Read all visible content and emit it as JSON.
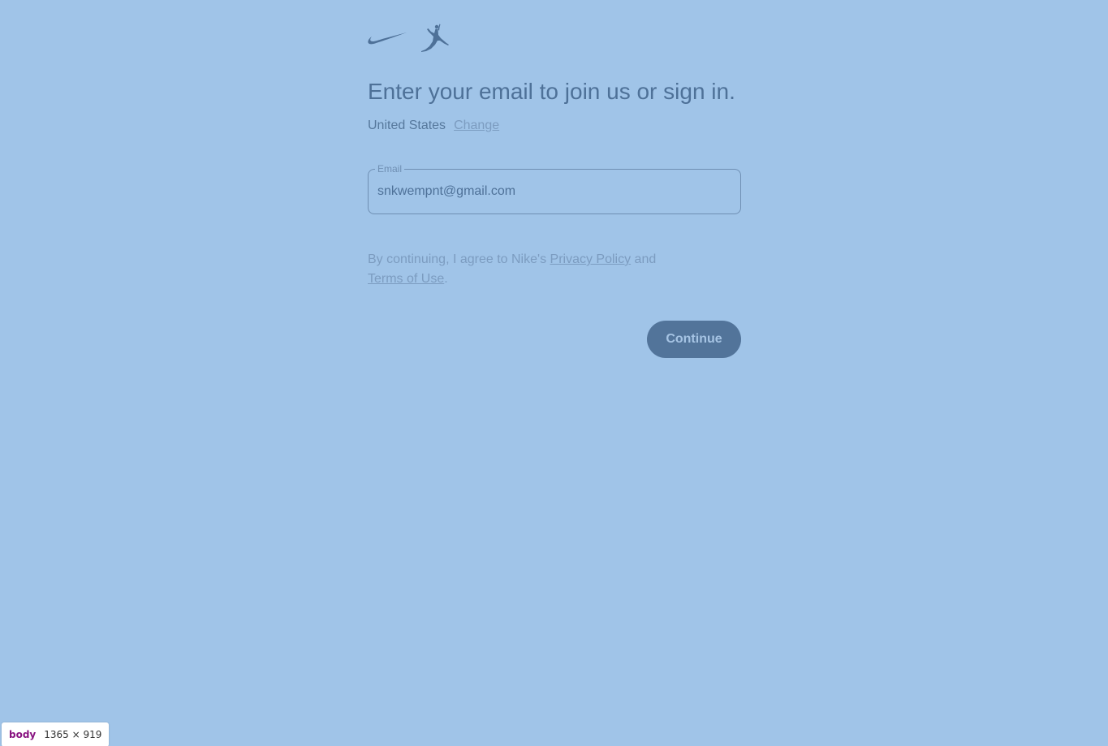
{
  "logos": {
    "nike": "nike-swoosh-icon",
    "jordan": "jumpman-icon",
    "color": "#4e7198"
  },
  "heading": "Enter your email to join us or sign in.",
  "location": {
    "country": "United States",
    "change_label": "Change"
  },
  "email_field": {
    "label": "Email",
    "value": "snkwempnt@gmail.com"
  },
  "terms": {
    "prefix": "By continuing, I agree to Nike's ",
    "privacy_link": "Privacy Policy",
    "middle": " and",
    "terms_link": "Terms of Use",
    "suffix": "."
  },
  "continue_button": {
    "label": "Continue"
  },
  "devtools_badge": {
    "tag": "body",
    "size": "1365 × 919"
  },
  "colors": {
    "background": "#a0c4e8",
    "button": "#52749a",
    "text": "#4e7198"
  }
}
